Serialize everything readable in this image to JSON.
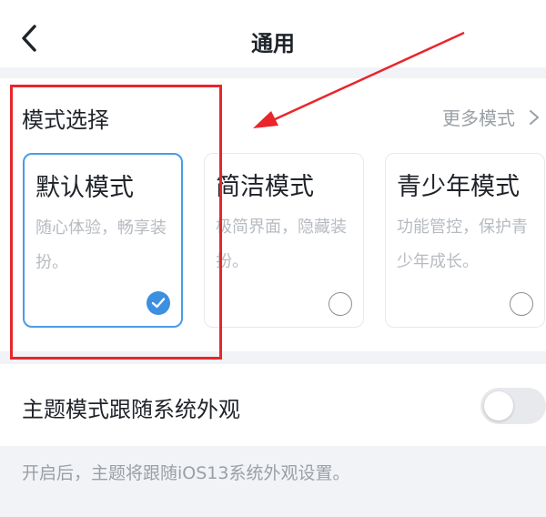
{
  "header": {
    "title": "通用",
    "back_icon": "chevron-left-icon"
  },
  "mode_section": {
    "title": "模式选择",
    "more_label": "更多模式",
    "more_icon": "chevron-right-icon",
    "cards": [
      {
        "title": "默认模式",
        "desc": "随心体验，畅享装扮。",
        "selected": true
      },
      {
        "title": "简洁模式",
        "desc": "极简界面，隐藏装扮。",
        "selected": false
      },
      {
        "title": "青少年模式",
        "desc": "功能管控，保护青少年成长。",
        "selected": false
      }
    ]
  },
  "theme_follow": {
    "label": "主题模式跟随系统外观",
    "enabled": false
  },
  "hint": "开启后，主题将跟随iOS13系统外观设置。",
  "colors": {
    "accent": "#3d8fe0",
    "annotation": "#e8262b"
  }
}
